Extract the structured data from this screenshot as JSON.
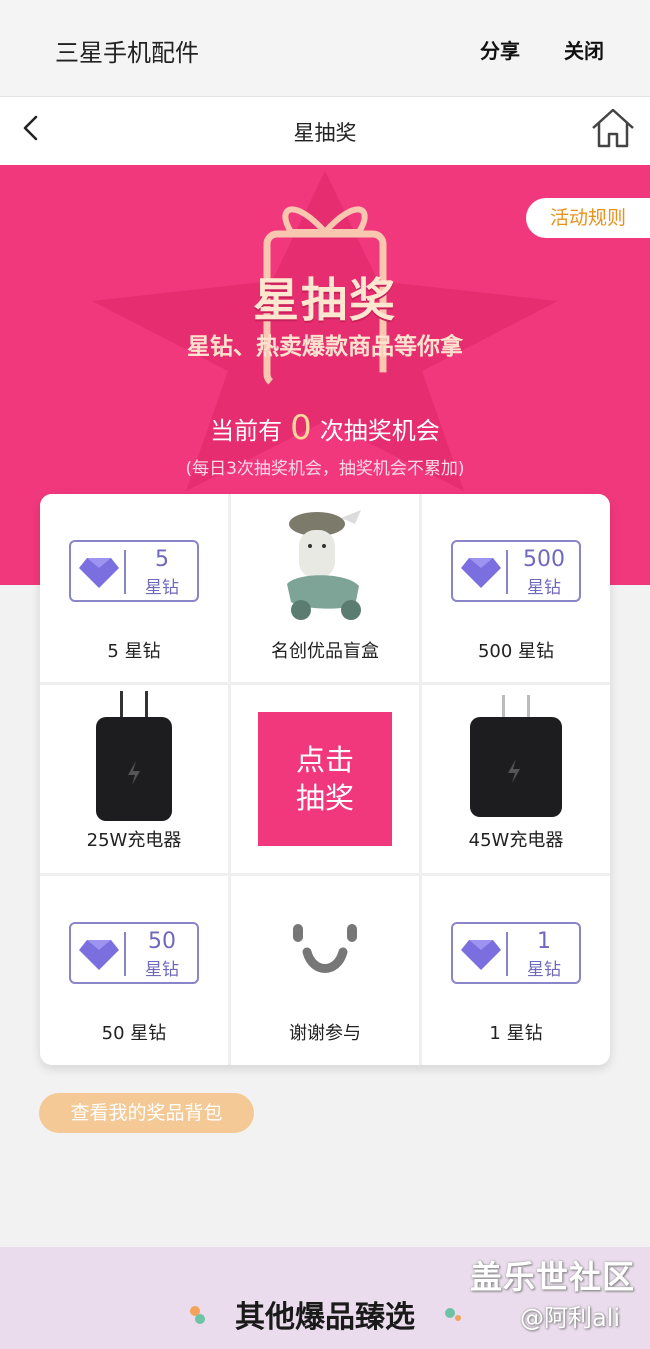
{
  "appbar": {
    "title": "三星手机配件",
    "share": "分享",
    "close": "关闭"
  },
  "navbar": {
    "title": "星抽奖",
    "back_icon": "back-arrow-icon",
    "home_icon": "home-icon"
  },
  "hero": {
    "rules": "活动规则",
    "title": "星抽奖",
    "subtitle": "星钻、热卖爆款商品等你拿",
    "chance_prefix": "当前有",
    "chance_count": "0",
    "chance_suffix": "次抽奖机会",
    "limit": "(每日3次抽奖机会，抽奖机会不累加)"
  },
  "grid": {
    "c1": {
      "num": "5",
      "unit": "星钻",
      "label": "5 星钻"
    },
    "c2": {
      "label": "名创优品盲盒"
    },
    "c3": {
      "num": "500",
      "unit": "星钻",
      "label": "500 星钻"
    },
    "c4": {
      "label": "25W充电器"
    },
    "draw_button_line1": "点击",
    "draw_button_line2": "抽奖",
    "c6": {
      "label": "45W充电器"
    },
    "c7": {
      "num": "50",
      "unit": "星钻",
      "label": "50 星钻"
    },
    "c8": {
      "label": "谢谢参与"
    },
    "c9": {
      "num": "1",
      "unit": "星钻",
      "label": "1 星钻"
    }
  },
  "bag_button": "查看我的奖品背包",
  "footer": {
    "title": "其他爆品臻选"
  },
  "watermark": {
    "line1": "盖乐世社区",
    "line2": "@阿利ali"
  },
  "colors": {
    "primary": "#f2387d",
    "gem": "#6f69bd",
    "rules_text": "#e8921e",
    "bag": "#f4c995"
  }
}
